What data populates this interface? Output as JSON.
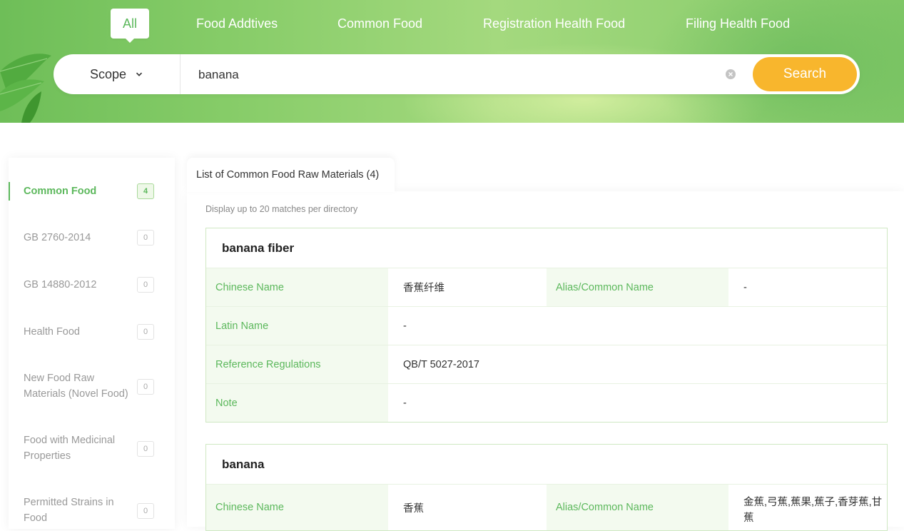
{
  "tabs": [
    {
      "label": "All",
      "active": true
    },
    {
      "label": "Food Addtives"
    },
    {
      "label": "Common Food"
    },
    {
      "label": "Registration Health Food"
    },
    {
      "label": "Filing Health Food"
    }
  ],
  "search": {
    "scope_label": "Scope",
    "query": "banana",
    "button_label": "Search"
  },
  "sidebar": {
    "items": [
      {
        "label": "Common Food",
        "count": "4",
        "active": true
      },
      {
        "label": "GB 2760-2014",
        "count": "0"
      },
      {
        "label": "GB 14880-2012",
        "count": "0"
      },
      {
        "label": "Health Food",
        "count": "0"
      },
      {
        "label": "New Food Raw Materials (Novel Food)",
        "count": "0"
      },
      {
        "label": "Food with Medicinal Properties",
        "count": "0"
      },
      {
        "label": "Permitted Strains in Food",
        "count": "0"
      }
    ]
  },
  "results": {
    "tab_label": "List of Common Food Raw Materials (4)",
    "hint": "Display up to 20 matches per directory",
    "labels": {
      "chinese_name": "Chinese Name",
      "alias": "Alias/Common Name",
      "latin_name": "Latin Name",
      "reference": "Reference Regulations",
      "note": "Note"
    },
    "cards": [
      {
        "title": "banana fiber",
        "chinese_name": "香蕉纤维",
        "alias": "-",
        "latin_name": "-",
        "reference": "QB/T 5027-2017",
        "note": "-"
      },
      {
        "title": "banana",
        "chinese_name": "香蕉",
        "alias": "金蕉,弓蕉,蕉果,蕉子,香芽蕉,甘蕉"
      }
    ]
  },
  "colors": {
    "accent_green": "#5cb85c",
    "search_button": "#f8b62d",
    "banner_green": "#86cc68"
  }
}
